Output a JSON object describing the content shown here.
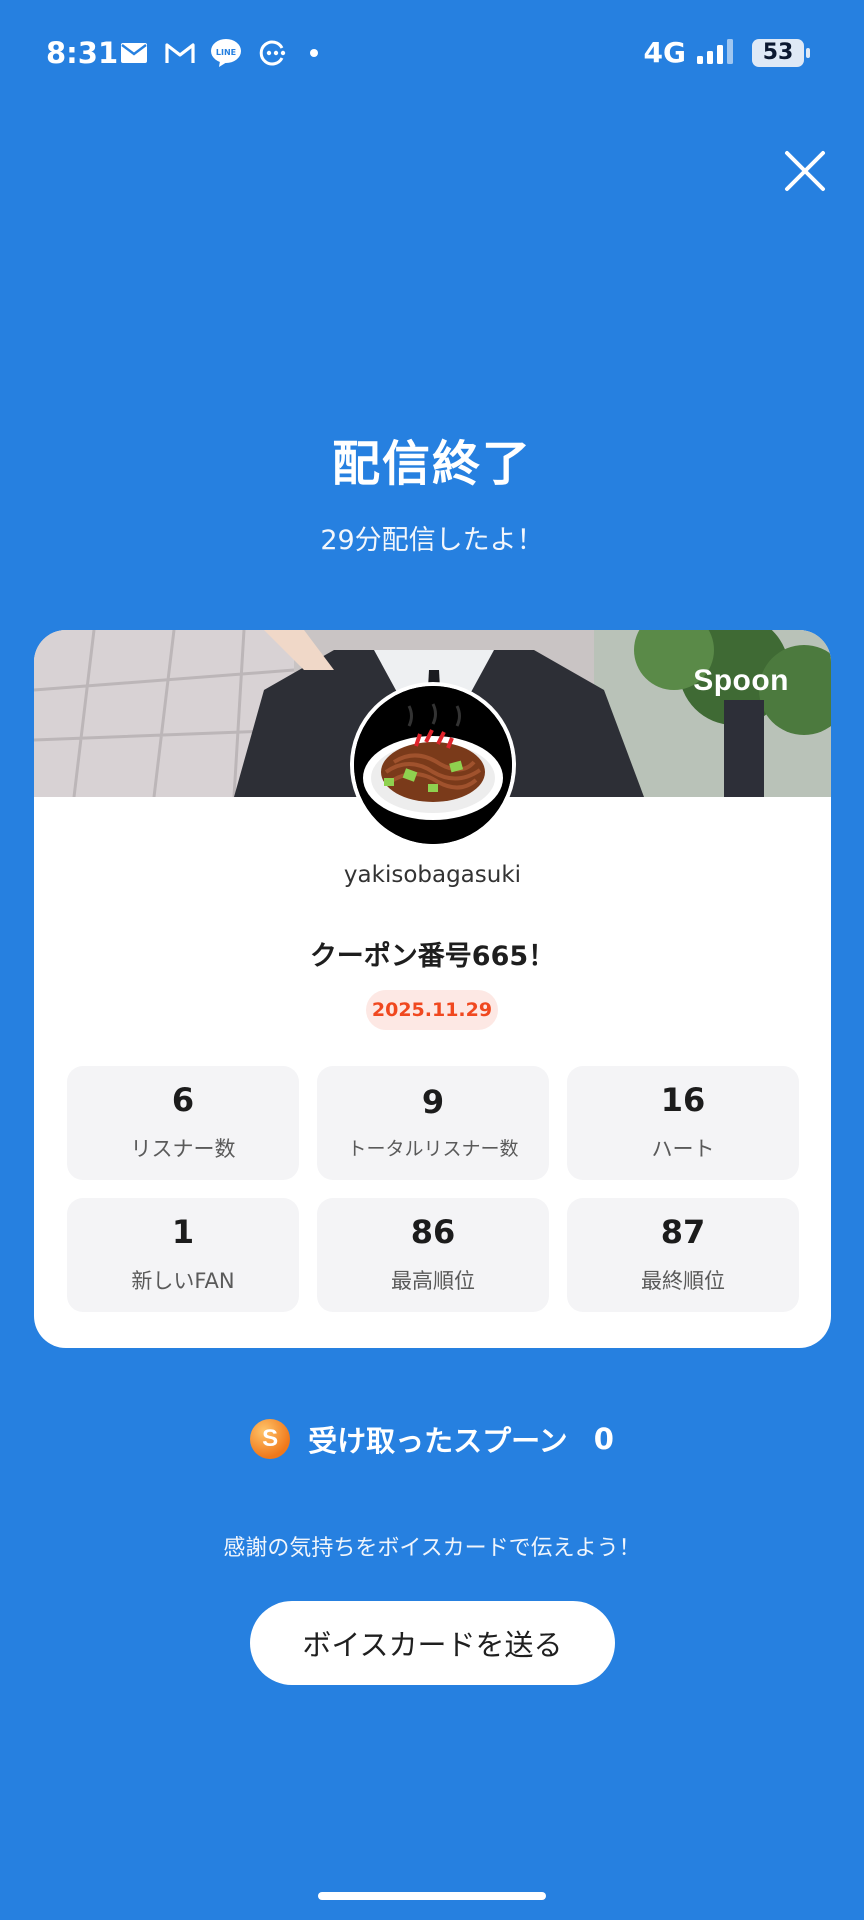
{
  "status_bar": {
    "time": "8:31",
    "network": "4G",
    "battery": "53",
    "notification_icons": [
      "mail-icon",
      "gmail-icon",
      "line-icon",
      "chat-icon"
    ]
  },
  "header": {
    "title": "配信終了",
    "subtitle": "29分配信したよ！"
  },
  "card": {
    "brand": "Spoon",
    "username": "yakisobagasuki",
    "coupon_title": "クーポン番号665！",
    "date": "2025.11.29",
    "stats": [
      {
        "value": "6",
        "label": "リスナー数"
      },
      {
        "value": "9",
        "label": "トータルリスナー数"
      },
      {
        "value": "16",
        "label": "ハート"
      },
      {
        "value": "1",
        "label": "新しいFAN"
      },
      {
        "value": "86",
        "label": "最高順位"
      },
      {
        "value": "87",
        "label": "最終順位"
      }
    ]
  },
  "spoons": {
    "icon_letter": "S",
    "label": "受け取ったスプーン",
    "count": "0"
  },
  "thanks_text": "感謝の気持ちをボイスカードで伝えよう！",
  "voice_card_button": "ボイスカードを送る",
  "colors": {
    "background": "#2680e0",
    "date_badge_text": "#f0481f",
    "date_badge_bg": "#fde8e4",
    "stat_tile_bg": "#f4f4f6"
  }
}
